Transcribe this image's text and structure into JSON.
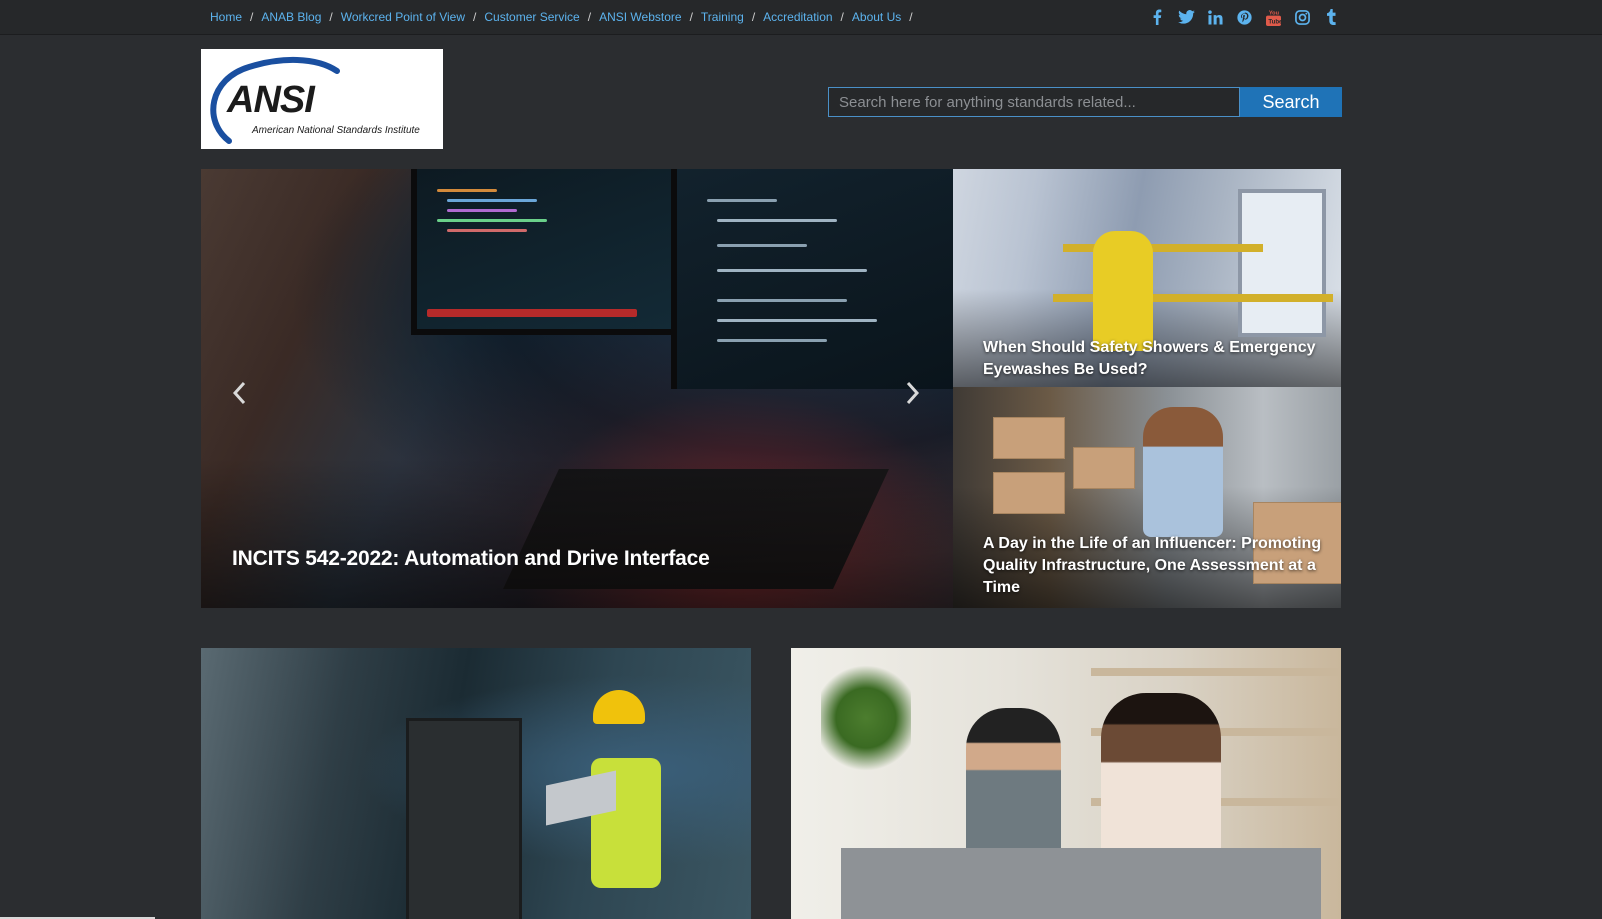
{
  "nav": {
    "breadcrumbs": [
      "Home",
      "ANAB Blog",
      "Workcred Point of View",
      "Customer Service",
      "ANSI Webstore",
      "Training",
      "Accreditation",
      "About Us"
    ],
    "separator": "/"
  },
  "social": {
    "icons": [
      "facebook-icon",
      "twitter-icon",
      "linkedin-icon",
      "pinterest-icon",
      "youtube-icon",
      "instagram-icon",
      "tumblr-icon"
    ],
    "color": "#5cb3ee",
    "youtube_color": "#e05a4a"
  },
  "logo": {
    "word": "ANSI",
    "subtitle": "American National Standards Institute"
  },
  "search": {
    "placeholder": "Search here for anything standards related...",
    "value": "",
    "button_label": "Search"
  },
  "hero": {
    "caption": "INCITS 542-2022: Automation and Drive Interface",
    "prev_icon": "chevron-left-icon",
    "next_icon": "chevron-right-icon"
  },
  "side_cards": [
    {
      "title_line1": "When Should Safety Showers & Emergency",
      "title_line2": "Eyewashes Be Used?"
    },
    {
      "title_line1": "A Day in the Life of an Influencer: Promoting",
      "title_line2": "Quality Infrastructure, One Assessment at a",
      "title_line3": "Time"
    }
  ],
  "colors": {
    "background": "#2b2d30",
    "topbar": "#26282a",
    "link": "#5cb3ee",
    "button": "#1f73b7",
    "logo_arc": "#1a4fa0"
  }
}
